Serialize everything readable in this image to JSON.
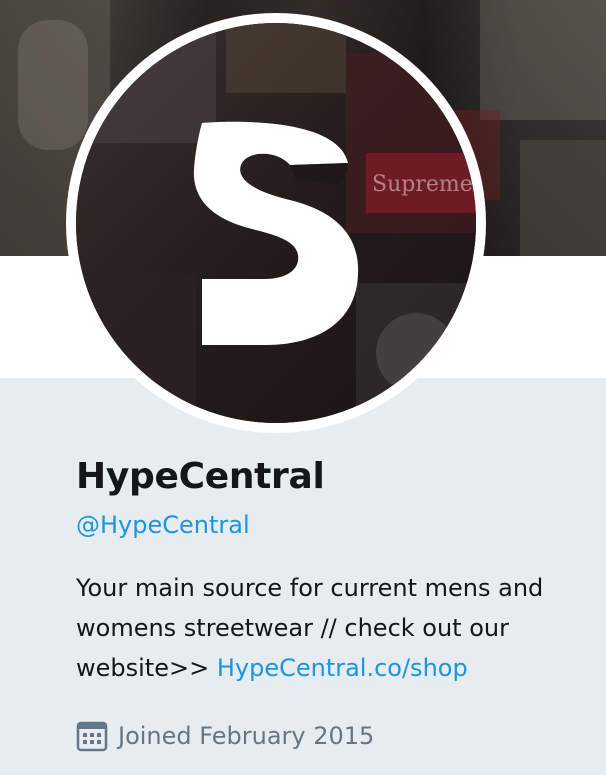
{
  "profile": {
    "display_name": "HypeCentral",
    "screen_name": "@HypeCentral",
    "bio_text": "Your main source for current mens and womens streetwear // check out our website>> ",
    "bio_link": "HypeCentral.co/shop",
    "joined_text": "Joined February 2015"
  },
  "avatar": {
    "logo_letter": "S",
    "background_word": "Supreme"
  },
  "icons": {
    "calendar": "calendar-icon"
  },
  "colors": {
    "link": "#1b95e0",
    "text_primary": "#14171a",
    "text_secondary": "#657786",
    "panel_background": "#e6ecf0",
    "banner_dark": "#2f2a27"
  }
}
